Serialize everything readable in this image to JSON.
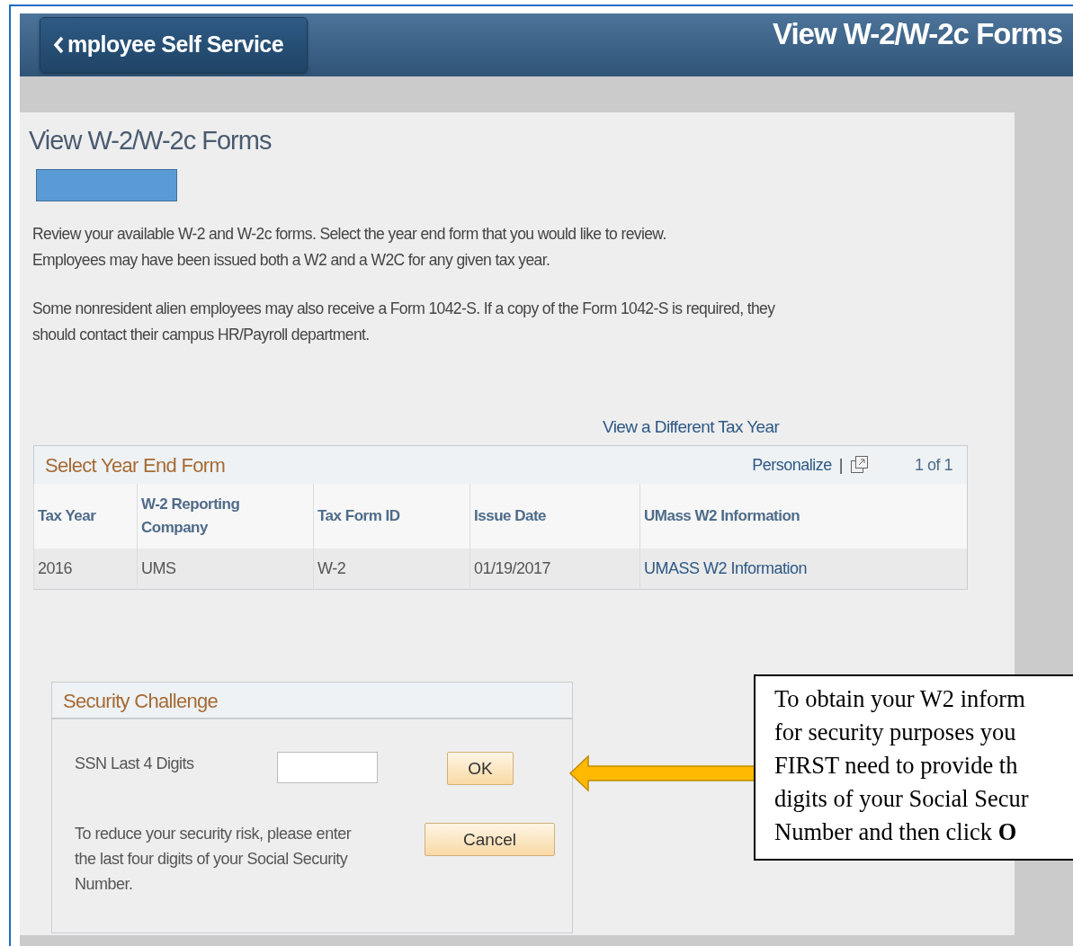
{
  "header": {
    "back_button": "mployee Self Service",
    "title": "View W-2/W-2c Forms"
  },
  "page_title": "View W-2/W-2c Forms",
  "paragraphs": [
    [
      "Review your available W-2 and W-2c forms. Select the year end form that you would like to review.",
      "Employees may have been issued both a W2 and a W2C for any given tax year."
    ],
    [
      "Some nonresident alien employees may also receive a Form 1042-S. If a copy of the Form 1042-S is required, they",
      "should contact their campus HR/Payroll department."
    ]
  ],
  "tax_year_link": "View a Different Tax Year",
  "grid": {
    "title": "Select Year End Form",
    "personalize": "Personalize",
    "separator": "|",
    "counter": "1 of 1",
    "columns": [
      "Tax Year",
      "W-2 Reporting Company",
      "Tax Form ID",
      "Issue Date",
      "UMass W2 Information"
    ],
    "rows": [
      {
        "cells": [
          {
            "kind": "text",
            "text": "2016"
          },
          {
            "kind": "text",
            "text": "UMS"
          },
          {
            "kind": "text",
            "text": "W-2"
          },
          {
            "kind": "text",
            "text": "01/19/2017"
          },
          {
            "kind": "link",
            "text": "UMASS W2 Information"
          }
        ]
      }
    ]
  },
  "security": {
    "title": "Security Challenge",
    "label": "SSN Last 4 Digits",
    "ok": "OK",
    "cancel": "Cancel",
    "note": "To reduce your security risk, please enter the last four digits of your Social Security Number."
  },
  "callout": {
    "lines": [
      "To obtain your W2 inform",
      "for security purposes you",
      "FIRST need to provide th",
      "digits of your Social Secur",
      "Number and then click **O**"
    ]
  }
}
